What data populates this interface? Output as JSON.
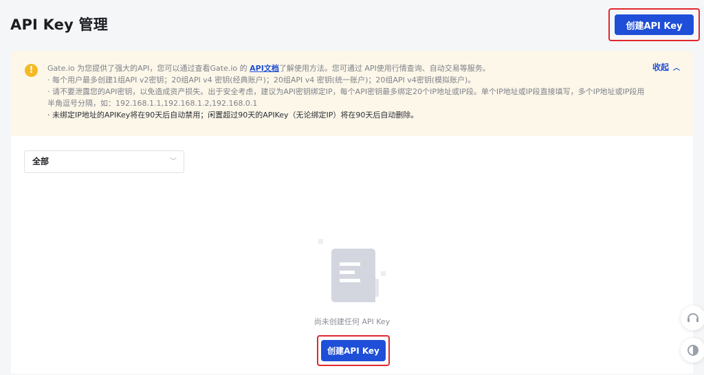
{
  "header": {
    "title": "API Key 管理",
    "create_button": "创建API Key"
  },
  "notice": {
    "icon": "warning-icon",
    "line1_prefix": "Gate.io 为您提供了强大的API，您可以通过查看Gate.io 的 ",
    "line1_link": "API文档",
    "line1_suffix": "了解使用方法。您可通过 API使用行情查询、自动交易等服务。",
    "line2": "· 每个用户最多创建1组API v2密钥；20组API v4 密钥(经典账户)；20组API v4 密钥(统一账户)；20组API v4密钥(模拟账户)。",
    "line3": "· 请不要泄露您的API密钥，以免造成资产损失。出于安全考虑，建议为API密钥绑定IP，每个API密钥最多绑定20个IP地址或IP段。单个IP地址或IP段直接填写，多个IP地址或IP段用半角逗号分隔，如：192.168.1.1,192.168.1.2,192.168.0.1",
    "line4": "· 未绑定IP地址的APIKey将在90天后自动禁用；闲置超过90天的APIKey（无论绑定IP）将在90天后自动删除。",
    "collapse_label": "收起"
  },
  "filter": {
    "selected": "全部"
  },
  "empty": {
    "text": "尚未创建任何 API Key",
    "create_button": "创建API Key"
  },
  "floating": {
    "support_icon": "headset-icon",
    "theme_icon": "theme-toggle-icon"
  },
  "colors": {
    "accent": "#1f4fd8",
    "highlight": "#e0252b",
    "notice_bg": "#fdf7e9",
    "warning": "#f5b924"
  }
}
